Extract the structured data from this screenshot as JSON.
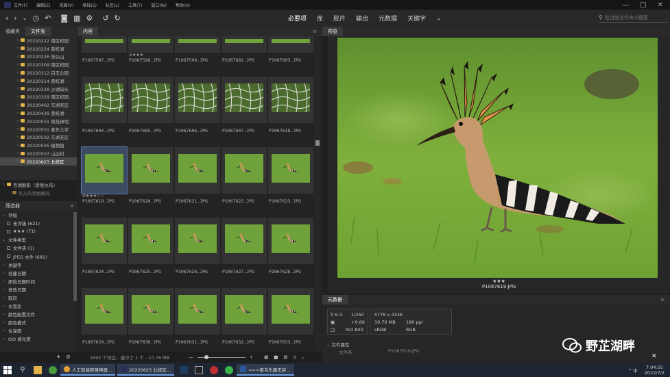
{
  "menubar": {
    "items": [
      "文件(F)",
      "编辑(E)",
      "视图(V)",
      "堆栈(S)",
      "标签(L)",
      "工具(T)",
      "窗口(W)",
      "帮助(H)"
    ],
    "window_controls": [
      "—",
      "□",
      "✕"
    ]
  },
  "toolbar": {
    "workspaces": [
      "必要项",
      "库",
      "胶片",
      "输出",
      "元数据",
      "关键字"
    ],
    "active_workspace": "必要项",
    "more": "⌄",
    "search_placeholder": "在当前文件夹中搜索"
  },
  "left_tabs": {
    "favorites": "收藏夹",
    "folders": "文件夹"
  },
  "folders": [
    {
      "name": "20220222 南区校园",
      "selected": false
    },
    {
      "name": "20220224 荔枝湖",
      "selected": false
    },
    {
      "name": "20220226 张公山",
      "selected": false
    },
    {
      "name": "20220309 南区校园",
      "selected": false
    },
    {
      "name": "20220312 白玉公园",
      "selected": false
    },
    {
      "name": "20220314 荔枝湖",
      "selected": false
    },
    {
      "name": "20220328 沙湖码头",
      "selected": false
    },
    {
      "name": "20220329 南区校园",
      "selected": false
    },
    {
      "name": "20220402 东湖老区",
      "selected": false
    },
    {
      "name": "20220429 荔枝湖",
      "selected": false
    },
    {
      "name": "20220501 简苑绿地",
      "selected": false
    },
    {
      "name": "20220501 老年大学",
      "selected": false
    },
    {
      "name": "20220502 东湖老区",
      "selected": false
    },
    {
      "name": "20220505 植物园",
      "selected": false
    },
    {
      "name": "20220507 山边村",
      "selected": false
    },
    {
      "name": "20220623 北校区",
      "selected": true
    }
  ],
  "folder_parent": "百湖魅影（爱我水鸟）",
  "folder_next": "鸟儿的美丽瞬间",
  "filter": {
    "title": "筛选器",
    "rows": [
      {
        "label": "评级",
        "type": "head"
      },
      {
        "label": "无评级 (621)",
        "type": "item"
      },
      {
        "label": "★★★ (71)",
        "type": "item"
      },
      {
        "label": "文件类型",
        "type": "head"
      },
      {
        "label": "文件夹 (1)",
        "type": "item"
      },
      {
        "label": "JPEG 文件 (691)",
        "type": "item"
      },
      {
        "label": "关键字",
        "type": "head"
      },
      {
        "label": "创建日期",
        "type": "head"
      },
      {
        "label": "原始日期时间",
        "type": "head"
      },
      {
        "label": "修改日期",
        "type": "head"
      },
      {
        "label": "取向",
        "type": "head"
      },
      {
        "label": "长宽比",
        "type": "head"
      },
      {
        "label": "颜色配置文件",
        "type": "head"
      },
      {
        "label": "颜色模式",
        "type": "head"
      },
      {
        "label": "位深度",
        "type": "head"
      },
      {
        "label": "ISO 感光度",
        "type": "head"
      }
    ]
  },
  "content": {
    "tab": "内容",
    "menu": "≡",
    "rows": [
      {
        "files": [
          "P1067597.JPG",
          "P1067598.JPG",
          "P1067599.JPG",
          "P1067602.JPG",
          "P1067603.JPG"
        ],
        "stars": [
          "",
          "⊘★★★",
          "",
          "",
          ""
        ],
        "thumb": "partial"
      },
      {
        "files": [
          "P1067604.JPG",
          "P1067605.JPG",
          "P1067606.JPG",
          "P1067607.JPG",
          "P1067618.JPG"
        ],
        "stars": [
          "",
          "",
          "",
          "",
          ""
        ],
        "thumb": "net"
      },
      {
        "files": [
          "P1067619.JPG",
          "P1067620.JPG",
          "P1067621.JPG",
          "P1067622.JPG",
          "P1067623.JPG"
        ],
        "stars": [
          "⊘★★★☆☆",
          "",
          "",
          "",
          ""
        ],
        "thumb": "bird"
      },
      {
        "files": [
          "P1067624.JPG",
          "P1067625.JPG",
          "P1067626.JPG",
          "P1067627.JPG",
          "P1067628.JPG"
        ],
        "stars": [
          "",
          "",
          "",
          "",
          ""
        ],
        "thumb": "bird"
      },
      {
        "files": [
          "P1067629.JPG",
          "P1067630.JPG",
          "P1067631.JPG",
          "P1067632.JPG",
          "P1067633.JPG"
        ],
        "stars": [
          "",
          "",
          "",
          "",
          ""
        ],
        "thumb": "bird"
      }
    ],
    "status": "1692 个项目，选中了 1 个 - 10.76 MB"
  },
  "preview": {
    "tab": "预览",
    "stars": "★★★",
    "filename": "P1067619.JPG"
  },
  "metadata": {
    "tab": "元数据",
    "aperture": "f/ 6.3",
    "shutter": "1/250",
    "ev": "+0.66",
    "iso": "ISO 800",
    "dimensions": "5776 x 4336",
    "size": "10.76 MB",
    "ppi": "180 ppi",
    "colorspace": "sRGB",
    "mode": "RGB",
    "file_props": "文件属性",
    "filename_label": "文件名",
    "filename_value": "P1067619.JPG"
  },
  "watermark": "野芷湖畔",
  "taskbar": {
    "tasks": [
      "人工智能降噪神器...",
      "20220623 北校区...",
      "===南鸟乐趣无穷..."
    ],
    "tray": "^ 中",
    "time": "7:04:55",
    "date": "2022/7/2"
  },
  "colors": {
    "accent": "#5b7bb5",
    "folder": "#e2b24a",
    "grass": "#6fa23b"
  }
}
